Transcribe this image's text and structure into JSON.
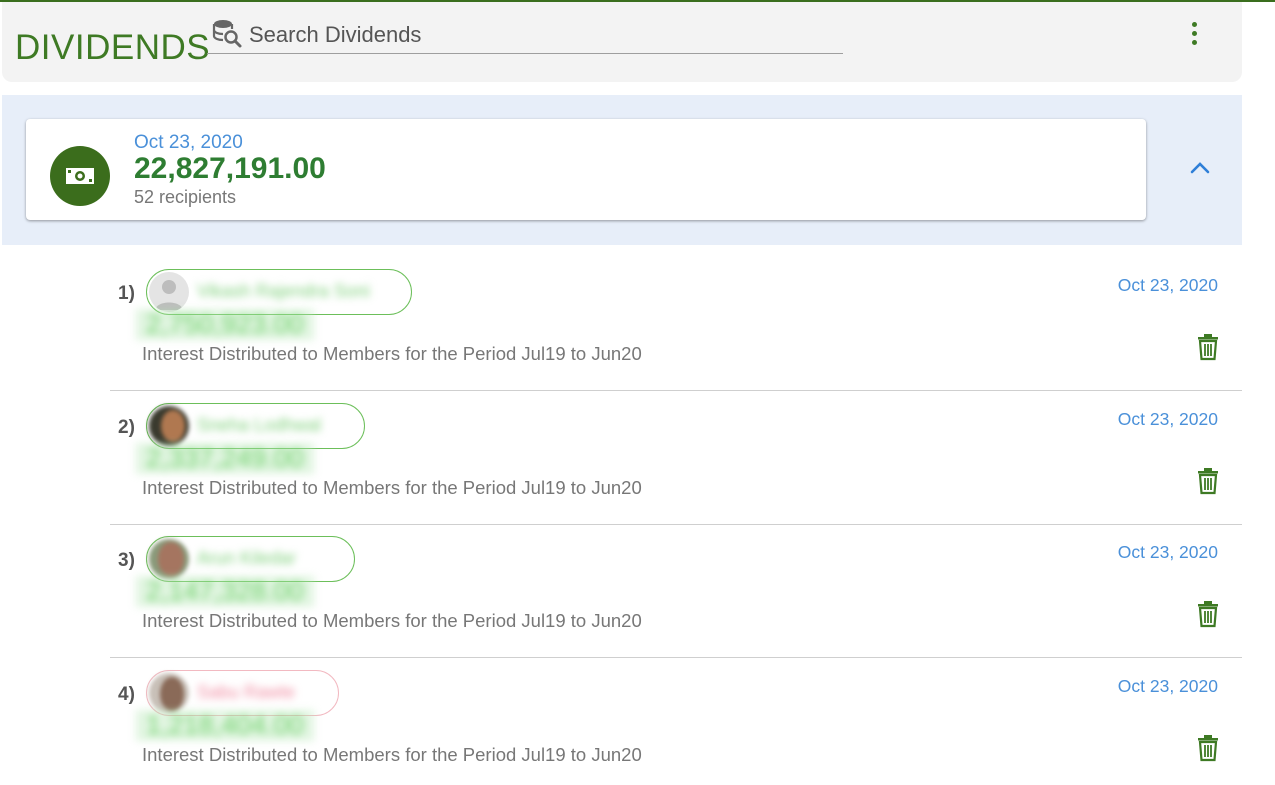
{
  "header": {
    "title": "DIVIDENDS",
    "search_placeholder": "Search Dividends",
    "search_value": ""
  },
  "summary": {
    "date": "Oct 23, 2020",
    "amount": "22,827,191.00",
    "recipients": "52 recipients"
  },
  "colors": {
    "accent_green": "#3e7a24",
    "amount_green": "#2e7d32",
    "link_blue": "#4a90d9",
    "band_blue": "#e7eef9"
  },
  "rows": [
    {
      "index": "1)",
      "name": "Vikash Rajendra Soni",
      "amount": "2,750,923.00",
      "description": "Interest Distributed to Members for the Period Jul19 to Jun20",
      "date": "Oct 23, 2020"
    },
    {
      "index": "2)",
      "name": "Sneha Lodhwal",
      "amount": "2,337,249.00",
      "description": "Interest Distributed to Members for the Period Jul19 to Jun20",
      "date": "Oct 23, 2020"
    },
    {
      "index": "3)",
      "name": "Arun Kiledar",
      "amount": "2,147,328.00",
      "description": "Interest Distributed to Members for the Period Jul19 to Jun20",
      "date": "Oct 23, 2020"
    },
    {
      "index": "4)",
      "name": "Sabu Rawte",
      "amount": "1,218,404.00",
      "description": "Interest Distributed to Members for the Period Jul19 to Jun20",
      "date": "Oct 23, 2020"
    }
  ]
}
